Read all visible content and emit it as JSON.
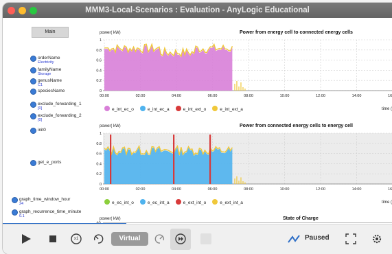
{
  "window": {
    "title": "MMM3-Local-Scenarios : Evaluation - AnyLogic Educational"
  },
  "main_button": "Main",
  "params": [
    {
      "name": "orderName",
      "value": "Electricity"
    },
    {
      "name": "familyName",
      "value": "Storage"
    },
    {
      "name": "genusName",
      "value": "C1"
    },
    {
      "name": "speciesName",
      "value": ""
    },
    {
      "name": "exclude_forwarding_1",
      "value": "[0]"
    },
    {
      "name": "exclude_forwarding_2",
      "value": "[0]"
    },
    {
      "name": "init0",
      "value": ""
    },
    {
      "name": "get_e_ports",
      "value": ""
    },
    {
      "name": "graph_time_window_hour",
      "value": "24"
    },
    {
      "name": "graph_recurrence_time_minute",
      "value": "0.1"
    }
  ],
  "chart_data": [
    {
      "type": "area",
      "title": "Power from energy cell to connected energy cells",
      "ylabel": "power( kW)",
      "xlabel": "time (",
      "ylim": [
        0,
        1
      ],
      "yticks": [
        "1",
        "0.8",
        "0.6",
        "0.4",
        "0.2",
        "0"
      ],
      "xticks": [
        "00:00",
        "02:00",
        "04:00",
        "06:00",
        "08:00",
        "10:00",
        "12:00",
        "14:00",
        "16:00"
      ],
      "grid": true,
      "legend_position": "bottom",
      "series": [
        {
          "name": "e_int_ec_o",
          "color": "#d87fd8"
        },
        {
          "name": "e_int_ec_a",
          "color": "#4fb3ee"
        },
        {
          "name": "e_int_ext_o",
          "color": "#d83a3a"
        },
        {
          "name": "e_int_ext_a",
          "color": "#f0c83a"
        }
      ]
    },
    {
      "type": "area",
      "title": "Power from connected energy cells to energy cell",
      "ylabel": "power( kW)",
      "xlabel": "time (",
      "ylim": [
        0,
        1
      ],
      "yticks": [
        "1",
        "0.8",
        "0.6",
        "0.4",
        "0.2",
        "0"
      ],
      "xticks": [
        "00:00",
        "02:00",
        "04:00",
        "06:00",
        "08:00",
        "10:00",
        "12:00",
        "14:00",
        "16:00"
      ],
      "grid": true,
      "legend_position": "bottom",
      "series": [
        {
          "name": "e_ec_int_o",
          "color": "#8ccf3c"
        },
        {
          "name": "e_ec_int_a",
          "color": "#4fb3ee"
        },
        {
          "name": "e_ext_int_o",
          "color": "#d83a3a"
        },
        {
          "name": "e_ext_int_a",
          "color": "#f0c83a"
        }
      ]
    },
    {
      "type": "area",
      "title": "State of Charge",
      "ylabel": "power( kW)",
      "yticks": [
        "40"
      ]
    }
  ],
  "toolbar": {
    "speed_label": "x1",
    "mode_label": "Virtual",
    "status_label": "Paused"
  },
  "colors": {
    "progress": "#2e6fc7",
    "accent": "#3a7bd5"
  }
}
